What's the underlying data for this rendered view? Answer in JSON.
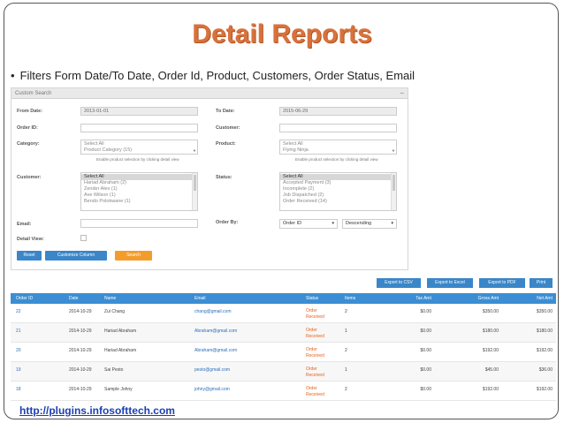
{
  "slide": {
    "title": "Detail Reports",
    "bullet": "Filters Form Date/To Date, Order Id, Product, Customers, Order Status, Email",
    "footer_url": "http://plugins.infosofttech.com"
  },
  "search": {
    "heading": "Custom Search",
    "collapse_glyph": "−",
    "from_date_label": "From Date:",
    "from_date_value": "2013-01-01",
    "to_date_label": "To Date:",
    "to_date_value": "2015-06-29",
    "order_id_label": "Order ID:",
    "customer_label": "Customer:",
    "category_label": "Category:",
    "category_options": [
      "Select All",
      "Product Category (15)"
    ],
    "category_hint": "Enable product selection by clicking detail view",
    "product_label": "Product:",
    "product_options": [
      "Select All",
      "Flying Ninja"
    ],
    "product_hint": "Enable product selection by clicking detail view",
    "customers_label": "Customer:",
    "customer_options": [
      "Select All",
      "Hariad Abraham (2)",
      "Zender Alex (1)",
      "Ave Wilson (1)",
      "Bendo Polokwane (1)"
    ],
    "status_label": "Status:",
    "status_options": [
      "Select All",
      "Accepted Payment (3)",
      "Incomplete (2)",
      "Job Dispatched (2)",
      "Order Received (14)"
    ],
    "email_label": "Email:",
    "order_by_label": "Order By:",
    "order_by_value": "Order ID",
    "order_dir_value": "Descending",
    "detail_view_label": "Detail View:",
    "reset_label": "Reset",
    "customize_label": "Customize Column",
    "search_label": "Search"
  },
  "exports": {
    "csv": "Export to CSV",
    "excel": "Export to Excel",
    "pdf": "Export to PDF",
    "print": "Print"
  },
  "table": {
    "headers": [
      "Order ID",
      "Date",
      "Name",
      "Email",
      "Status",
      "Items",
      "Tax Amt",
      "Gross Amt",
      "Net Amt"
    ],
    "rows": [
      [
        "22",
        "2014-10-29",
        "Zui Chang",
        "chang@gmail.com",
        "Order",
        "Received",
        "2",
        "$0.00",
        "$350.00",
        "$350.00"
      ],
      [
        "21",
        "2014-10-29",
        "Hariad Abraham",
        "Abraham@gmail.com",
        "Order",
        "Received",
        "1",
        "$0.00",
        "$180.00",
        "$180.00"
      ],
      [
        "20",
        "2014-10-29",
        "Hariad Abraham",
        "Abraham@gmail.com",
        "Order",
        "Received",
        "2",
        "$0.00",
        "$192.00",
        "$192.00"
      ],
      [
        "19",
        "2014-10-29",
        "Sai Pesto",
        "pesto@gmail.com",
        "Order",
        "Received",
        "1",
        "$0.00",
        "$45.00",
        "$36.00"
      ],
      [
        "18",
        "2014-10-29",
        "Sample Johny",
        "johny@gmail.com",
        "Order",
        "Received",
        "2",
        "$0.00",
        "$192.00",
        "$192.00"
      ]
    ]
  },
  "colors": {
    "title": "#d8723c",
    "primary_button": "#3a86c8",
    "search_button": "#f39c2c",
    "table_header": "#3b8ed3",
    "status_text": "#e5621c",
    "link": "#2a6ebb"
  }
}
